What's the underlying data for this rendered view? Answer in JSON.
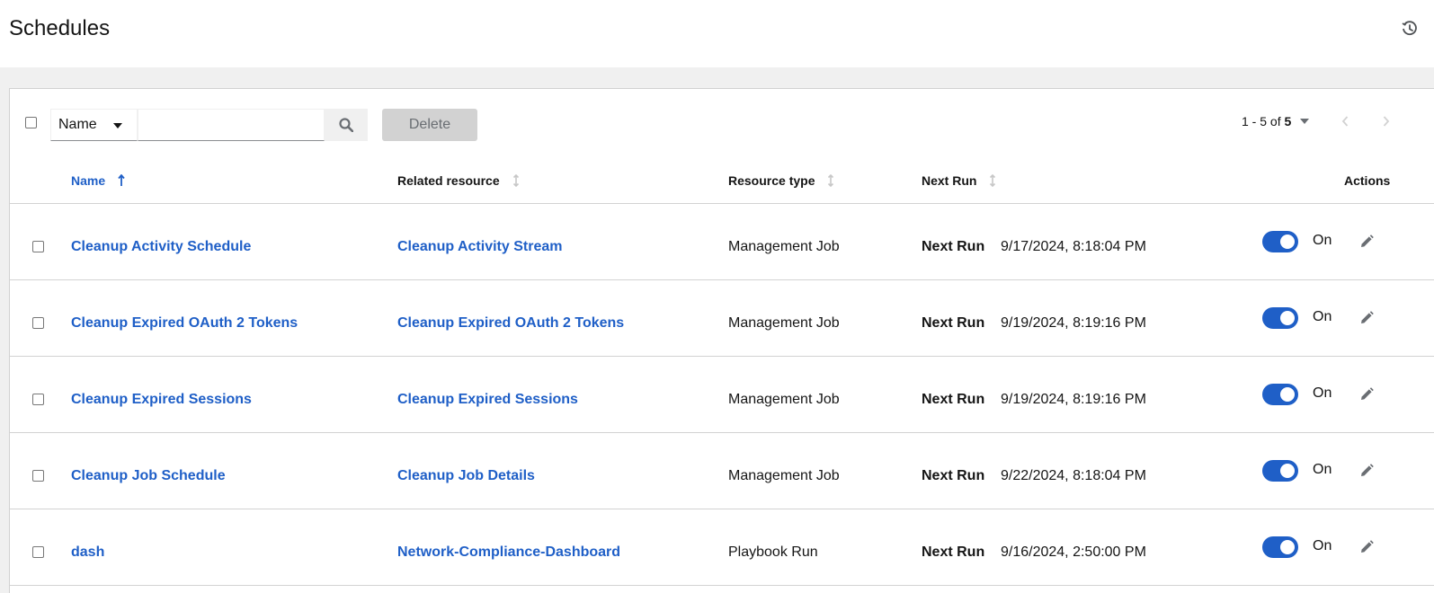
{
  "header": {
    "title": "Schedules"
  },
  "toolbar": {
    "filter_selected": "Name",
    "search_value": "",
    "search_placeholder": "",
    "delete_label": "Delete",
    "pagination_range": "1 - 5",
    "pagination_of": "of",
    "pagination_total": "5"
  },
  "table": {
    "columns": [
      "Name",
      "Related resource",
      "Resource type",
      "Next Run",
      "Actions"
    ],
    "sorted_column": "Name",
    "sort_direction": "ascending",
    "rows": [
      {
        "name": "Cleanup Activity Schedule",
        "related": "Cleanup Activity Stream",
        "type": "Management Job",
        "next_run_label": "Next Run",
        "next_run": "9/17/2024, 8:18:04 PM",
        "toggle": "On",
        "enabled": true
      },
      {
        "name": "Cleanup Expired OAuth 2 Tokens",
        "related": "Cleanup Expired OAuth 2 Tokens",
        "type": "Management Job",
        "next_run_label": "Next Run",
        "next_run": "9/19/2024, 8:19:16 PM",
        "toggle": "On",
        "enabled": true
      },
      {
        "name": "Cleanup Expired Sessions",
        "related": "Cleanup Expired Sessions",
        "type": "Management Job",
        "next_run_label": "Next Run",
        "next_run": "9/19/2024, 8:19:16 PM",
        "toggle": "On",
        "enabled": true
      },
      {
        "name": "Cleanup Job Schedule",
        "related": "Cleanup Job Details",
        "type": "Management Job",
        "next_run_label": "Next Run",
        "next_run": "9/22/2024, 8:18:04 PM",
        "toggle": "On",
        "enabled": true
      },
      {
        "name": "dash",
        "related": "Network-Compliance-Dashboard",
        "type": "Playbook Run",
        "next_run_label": "Next Run",
        "next_run": "9/16/2024, 2:50:00 PM",
        "toggle": "On",
        "enabled": true
      }
    ]
  },
  "icons": {
    "history": "history-icon",
    "search": "search-icon",
    "prev": "angle-left-icon",
    "next": "angle-right-icon",
    "edit": "pencil-icon",
    "sort_active": "long-arrow-up-icon",
    "sort_inactive": "arrows-alt-v-icon"
  },
  "colors": {
    "link": "#1f5fc7",
    "toggle_on": "#1f5fc7",
    "background": "#f0f0f0"
  }
}
